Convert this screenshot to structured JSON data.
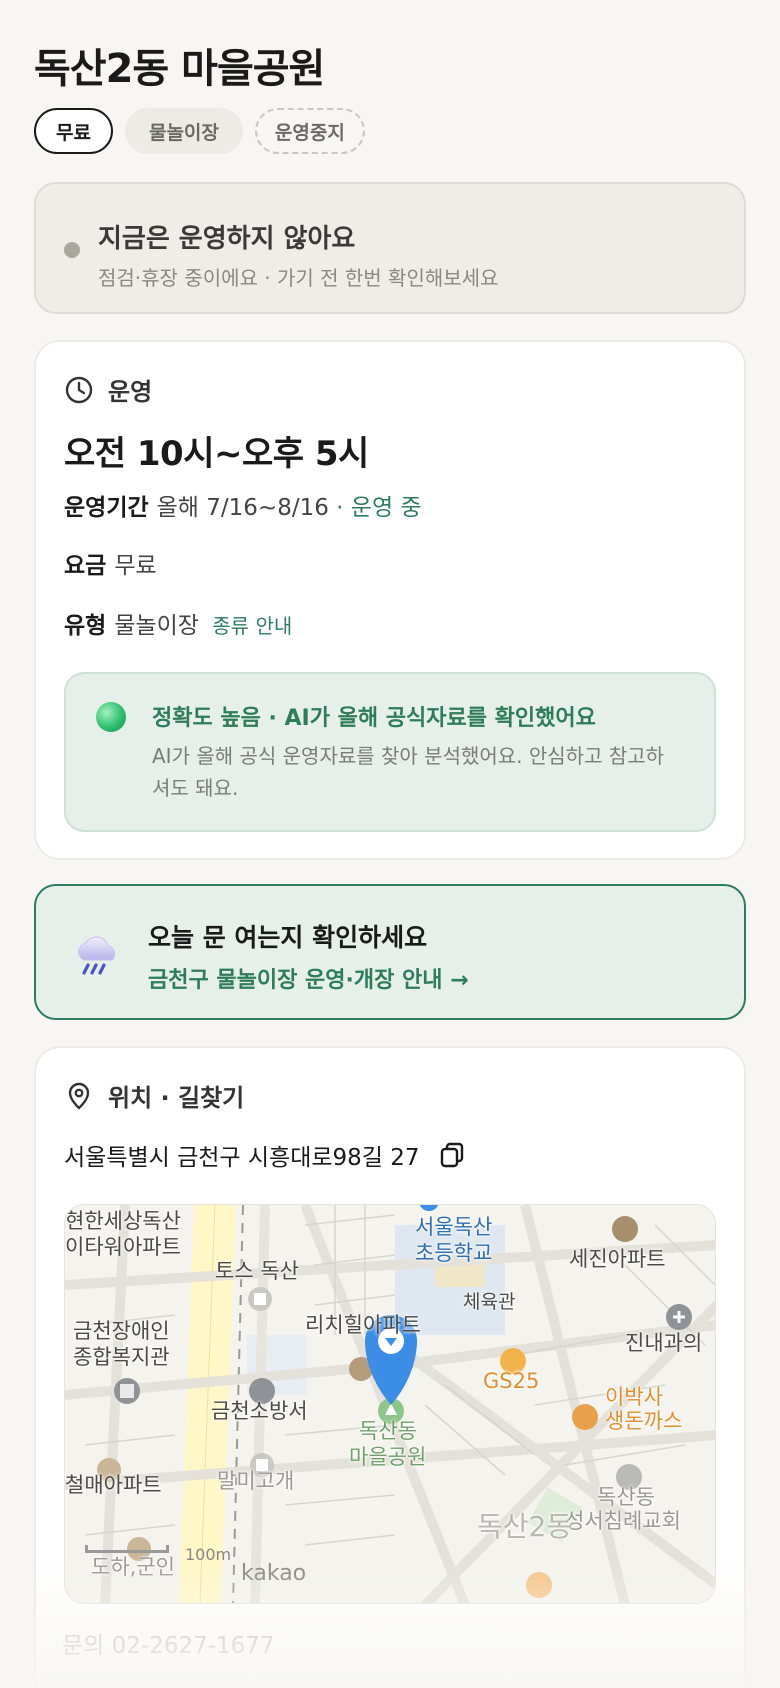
{
  "header": {
    "title": "독산2동 마을공원",
    "chips": [
      "무료",
      "물놀이장",
      "운영중지"
    ]
  },
  "status": {
    "title": "지금은 운영하지 않아요",
    "subtitle": "점검·휴장 중이에요 · 가기 전 한번 확인해보세요"
  },
  "hours": {
    "section_label": "운영",
    "time": "오전 10시~오후 5시",
    "period_label": "운영기간",
    "period_value": "올해 7/16~8/16",
    "period_status": "· 운영 중",
    "fee_label": "요금",
    "fee_value": "무료",
    "type_label": "유형",
    "type_value": "물놀이장",
    "type_link": "종류 안내",
    "ai_title": "정확도 높음 · AI가 올해 공식자료를 확인했어요",
    "ai_text": "AI가 올해 공식 운영자료를 찾아 분석했어요. 안심하고 참고하셔도 돼요."
  },
  "notice": {
    "title": "오늘 문 여는지 확인하세요",
    "link": "금천구 물놀이장 운영·개장 안내 →"
  },
  "location": {
    "section_label": "위치 · 길찾기",
    "address": "서울특별시 금천구 시흥대로98길 27",
    "map": {
      "labels": {
        "l1": "현한세상독산",
        "l2": "이타워아파트",
        "l3": "토스 독산",
        "l4": "서울독산",
        "l5": "초등학교",
        "l6": "세진아파트",
        "l7": "체육관",
        "l8": "금천장애인",
        "l9": "종합복지관",
        "l10": "리치힐아파트",
        "l11": "진내과의",
        "l12": "GS25",
        "l13": "금천소방서",
        "l14": "이박사",
        "l15": "생돈까스",
        "l16": "독산동",
        "l17": "마을공원",
        "l18": "말미고개",
        "l19": "철매아파트",
        "l20": "독산동",
        "l21": "성서침례교회",
        "l22": "독산2동",
        "l23": "도하,군인"
      },
      "scale": "100m",
      "brand": "kakao"
    }
  },
  "contact": "문의 02-2627-1677",
  "colors": {
    "accent": "#2e7d59",
    "background": "#f7f6f2",
    "status_bg": "#efede7",
    "ai_bg": "#e6efe9"
  }
}
